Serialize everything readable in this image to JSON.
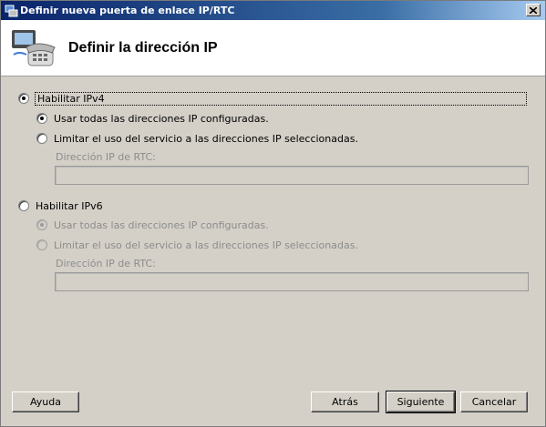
{
  "window": {
    "title": "Definir nueva puerta de enlace IP/RTC",
    "close_label": "X"
  },
  "header": {
    "title": "Definir la dirección IP"
  },
  "ipv4": {
    "enable_label": "Habilitar IPv4",
    "enabled": true,
    "use_all_label": "Usar todas las direcciones IP configuradas.",
    "limit_label": "Limitar el uso del servicio a las direcciones IP seleccionadas.",
    "selected_option": "use_all",
    "rtc_ip_label": "Dirección IP de RTC:",
    "rtc_ip_value": ""
  },
  "ipv6": {
    "enable_label": "Habilitar IPv6",
    "enabled": false,
    "use_all_label": "Usar todas las direcciones IP configuradas.",
    "limit_label": "Limitar el uso del servicio a las direcciones IP seleccionadas.",
    "selected_option": "use_all",
    "rtc_ip_label": "Dirección IP de RTC:",
    "rtc_ip_value": ""
  },
  "buttons": {
    "help": "Ayuda",
    "back": "Atrás",
    "next": "Siguiente",
    "cancel": "Cancelar"
  }
}
